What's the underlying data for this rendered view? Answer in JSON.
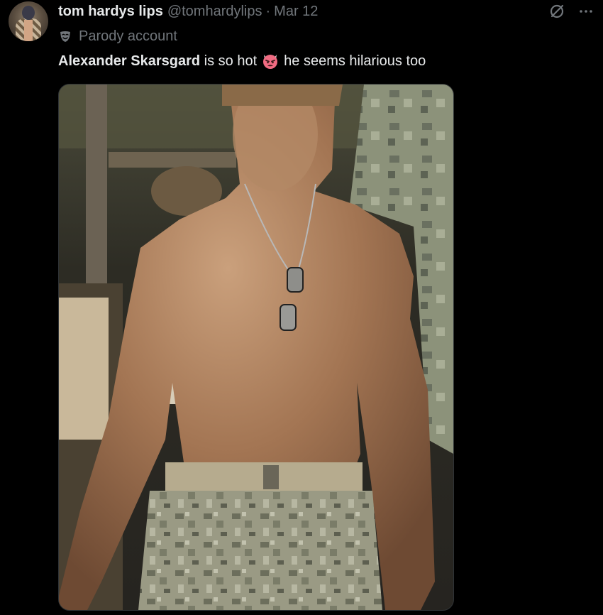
{
  "tweet": {
    "display_name": "tom hardys lips",
    "handle": "@tomhardylips",
    "separator": "·",
    "date": "Mar 12",
    "parody_label": "Parody account",
    "text_bold": "Alexander Skarsgard",
    "text_before_emoji": " is so hot",
    "emoji": "horned-red-face-emoji",
    "text_after_emoji": "he seems hilarious too"
  },
  "media": {
    "description_icon": "photo"
  },
  "colors": {
    "background": "#000000",
    "primary_text": "#e7e9ea",
    "secondary_text": "#71767b",
    "border": "#2f3336"
  }
}
